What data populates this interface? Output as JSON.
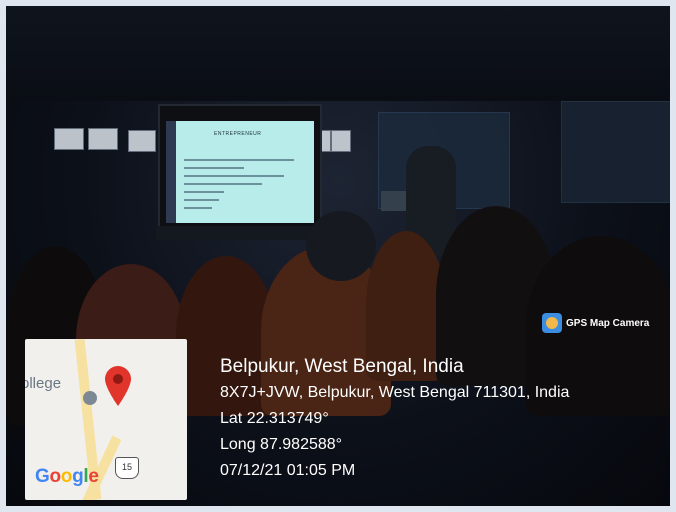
{
  "badge": {
    "label": "GPS Map Camera",
    "icon": "camera-pin-icon"
  },
  "map": {
    "place_label": "ollege",
    "road_shield": "15",
    "brand": "Google"
  },
  "info": {
    "place": "Belpukur, West Bengal, India",
    "address": "8X7J+JVW, Belpukur, West Bengal 711301, India",
    "latitude": "Lat 22.313749°",
    "longitude": "Long 87.982588°",
    "datetime": "07/12/21 01:05 PM"
  }
}
